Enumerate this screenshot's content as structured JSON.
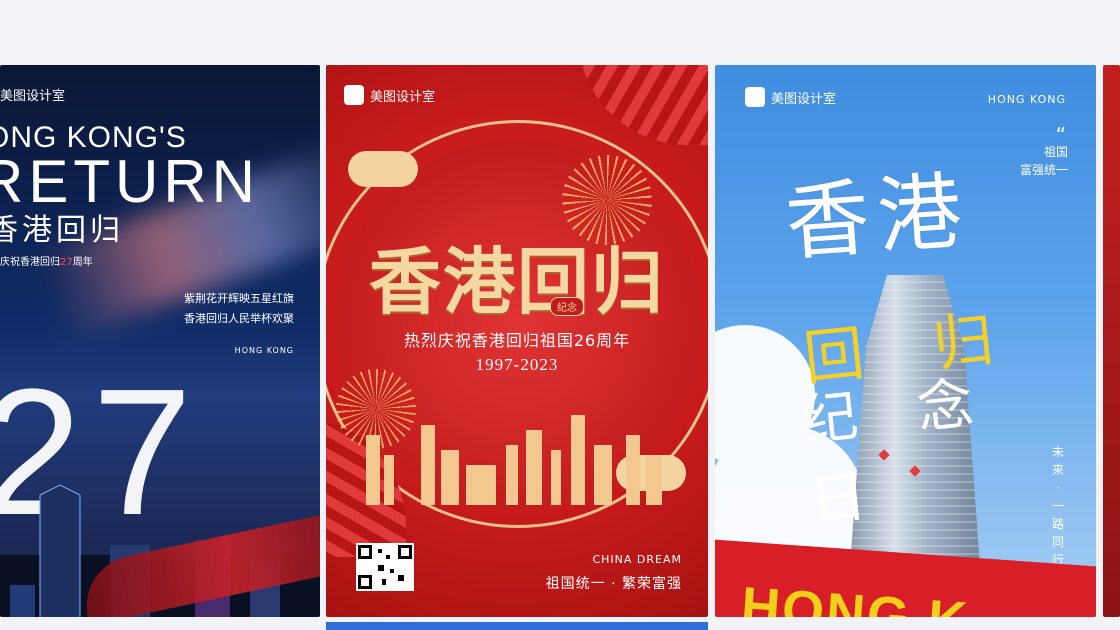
{
  "cards": [
    {
      "brand": "美图设计室",
      "title1": "ONG KONG'S",
      "title2": "RETURN",
      "title3": "香港回归",
      "subtitle_pre": "庆祝香港回归",
      "subtitle_num": "27",
      "subtitle_post": "周年",
      "poem": [
        "紫荆花开辉映五星红旗",
        "香港回归人民举杯欢聚"
      ],
      "location": "HONG KONG",
      "big_number": "27"
    },
    {
      "brand": "美图设计室",
      "title": "香港回归",
      "seal": "纪念",
      "line1": "热烈庆祝香港回归祖国26周年",
      "line2": "1997-2023",
      "tagline_en": "CHINA DREAM",
      "slogan": "祖国统一 · 繁荣富强"
    },
    {
      "brand": "美图设计室",
      "location": "HONG KONG",
      "quote_mark": "“",
      "quote": [
        "祖国",
        "富强统一"
      ],
      "hand_title": "香港",
      "hand_yellow": "回归",
      "hand_white": "纪念日",
      "side": [
        "未",
        "来",
        "·",
        "一",
        "路",
        "同",
        "行"
      ],
      "banner": "HONG K"
    }
  ],
  "colors": {
    "red": "#c81b1b",
    "gold": "#f5d7a2",
    "sky": "#3f8de0",
    "yellow": "#f3d12a"
  }
}
